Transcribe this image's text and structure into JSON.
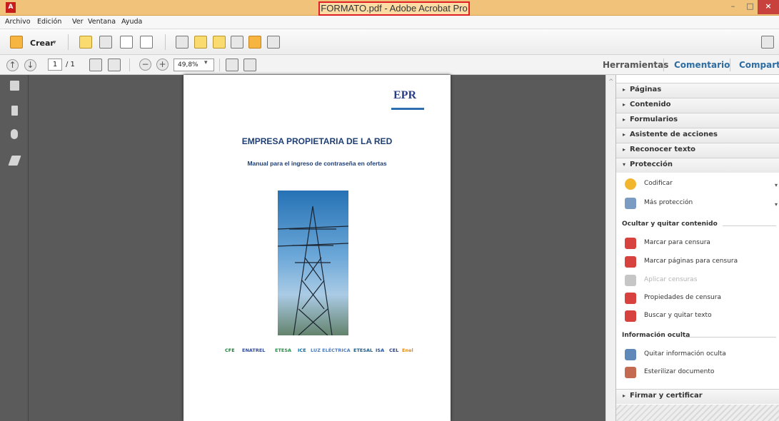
{
  "window": {
    "title": "FORMATO.pdf - Adobe Acrobat Pro",
    "minimize": "–",
    "maximize": "□",
    "close": "×"
  },
  "menu": [
    "Archivo",
    "Edición",
    "Ver",
    "Ventana",
    "Ayuda"
  ],
  "toolbar": {
    "create_label": "Crear",
    "dropdown": "▾"
  },
  "nav": {
    "page_current": "1",
    "page_total": "/ 1",
    "zoom": "49,8%",
    "zoom_dropdown": "▾"
  },
  "tabs": [
    {
      "label": "Herramientas"
    },
    {
      "label": "Comentario"
    },
    {
      "label": "Compartir"
    }
  ],
  "document": {
    "logo_text": "EPR",
    "title": "EMPRESA PROPIETARIA DE LA RED",
    "subtitle": "Manual para el ingreso de contraseña en ofertas",
    "sponsors": [
      "CFE",
      "ENATREL",
      "ETESA",
      "ICE",
      "LUZ ELÉCTRICA",
      "ETESAL",
      "ISA",
      "CEL",
      "Enel"
    ]
  },
  "sidebar": {
    "panels_collapsed": [
      "Páginas",
      "Contenido",
      "Formularios",
      "Asistente de acciones",
      "Reconocer texto"
    ],
    "protection": {
      "label": "Protección",
      "items": [
        {
          "label": "Codificar",
          "dropdown": "▾",
          "icon": "shield-icon",
          "color": "#f1b52e"
        },
        {
          "label": "Más protección",
          "dropdown": "▾",
          "icon": "protection-doc-icon",
          "color": "#7a9bc2"
        }
      ]
    },
    "hide_remove": {
      "title": "Ocultar y quitar contenido",
      "items": [
        {
          "label": "Marcar para censura",
          "icon": "redact-icon",
          "color": "#d8423e",
          "enabled": true
        },
        {
          "label": "Marcar páginas para censura",
          "icon": "redact-pages-icon",
          "color": "#d8423e",
          "enabled": true
        },
        {
          "label": "Aplicar censuras",
          "icon": "apply-redactions-icon",
          "color": "#c6c6c6",
          "enabled": false
        },
        {
          "label": "Propiedades de censura",
          "icon": "redaction-properties-icon",
          "color": "#d8423e",
          "enabled": true
        },
        {
          "label": "Buscar y quitar texto",
          "icon": "search-remove-icon",
          "color": "#d8423e",
          "enabled": true
        }
      ]
    },
    "hidden_info": {
      "title": "Información oculta",
      "items": [
        {
          "label": "Quitar información oculta",
          "icon": "remove-info-icon",
          "color": "#5e89b8"
        },
        {
          "label": "Esterilizar documento",
          "icon": "sanitize-icon",
          "color": "#c46a51"
        }
      ]
    },
    "sign": {
      "label": "Firmar y certificar"
    }
  },
  "colors": {
    "accent_tab": "#2d6da3",
    "title_highlight": "#e01f26"
  }
}
